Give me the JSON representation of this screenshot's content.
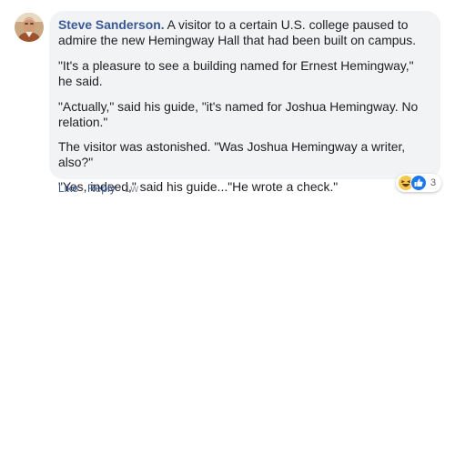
{
  "comment": {
    "author": "Steve Sanderson.",
    "paragraphs": [
      "A visitor to a certain U.S. college paused to admire the new Hemingway Hall that had been built on campus.",
      "\"It's a pleasure to see a building named for Ernest Hemingway,\" he said.",
      "\"Actually,\" said his guide, \"it's named for Joshua Hemingway. No relation.\"",
      "The visitor was astonished. \"Was Joshua Hemingway a writer, also?\"",
      "\"Yes, indeed,\" said his guide...\"He wrote a check.\""
    ]
  },
  "reactions": {
    "icons": [
      "laugh-emoji-icon",
      "like-thumb-icon"
    ],
    "count": "3"
  },
  "actions": {
    "like_label": "Like",
    "separator": "·",
    "reply_label": "Reply",
    "timestamp": "1w"
  },
  "colors": {
    "author": "#385898",
    "bubble": "#f2f3f5",
    "link": "#385898",
    "meta": "#90949c",
    "like_blue": "#1877f2",
    "haha_yellow": "#f7c84a"
  }
}
